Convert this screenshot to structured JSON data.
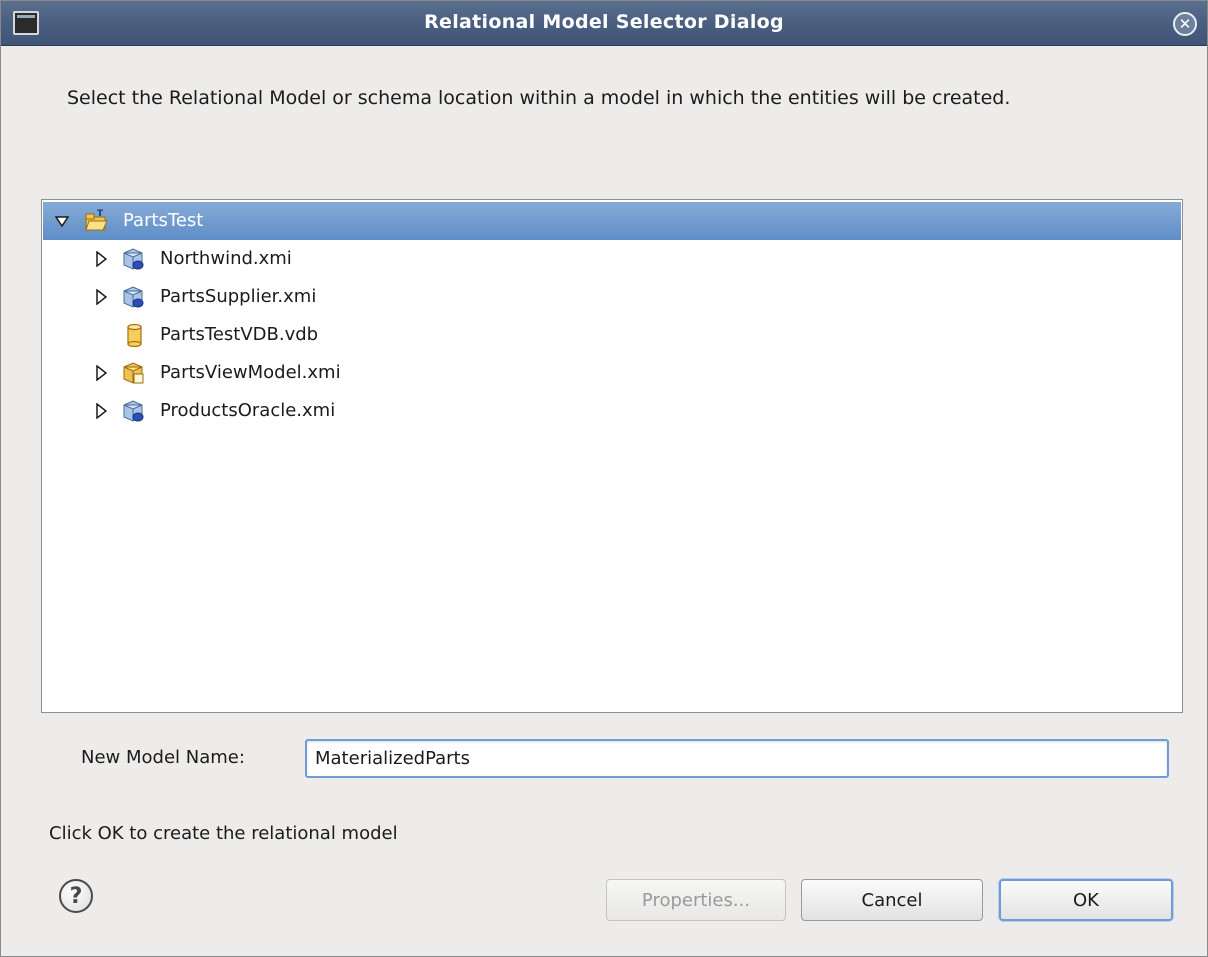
{
  "window": {
    "title": "Relational Model Selector Dialog"
  },
  "instruction": "Select the Relational Model or schema location within a model in which the entities will be created.",
  "tree": {
    "items": [
      {
        "label": "PartsTest",
        "icon": "project-folder-icon",
        "expandable": true,
        "expanded": true,
        "selected": true,
        "level": 0
      },
      {
        "label": "Northwind.xmi",
        "icon": "source-model-icon",
        "expandable": true,
        "expanded": false,
        "selected": false,
        "level": 1
      },
      {
        "label": "PartsSupplier.xmi",
        "icon": "source-model-icon",
        "expandable": true,
        "expanded": false,
        "selected": false,
        "level": 1
      },
      {
        "label": "PartsTestVDB.vdb",
        "icon": "vdb-icon",
        "expandable": false,
        "expanded": false,
        "selected": false,
        "level": 1
      },
      {
        "label": "PartsViewModel.xmi",
        "icon": "view-model-icon",
        "expandable": true,
        "expanded": false,
        "selected": false,
        "level": 1
      },
      {
        "label": "ProductsOracle.xmi",
        "icon": "source-model-icon",
        "expandable": true,
        "expanded": false,
        "selected": false,
        "level": 1
      }
    ]
  },
  "model_name": {
    "label": "New Model Name:",
    "value": "MaterializedParts"
  },
  "status": "Click OK to create the relational model",
  "buttons": {
    "properties": "Properties...",
    "cancel": "Cancel",
    "ok": "OK"
  },
  "colors": {
    "selection": "#5f8ec8",
    "titlebar": "#4a5f80",
    "dialog_bg": "#edeceb"
  }
}
